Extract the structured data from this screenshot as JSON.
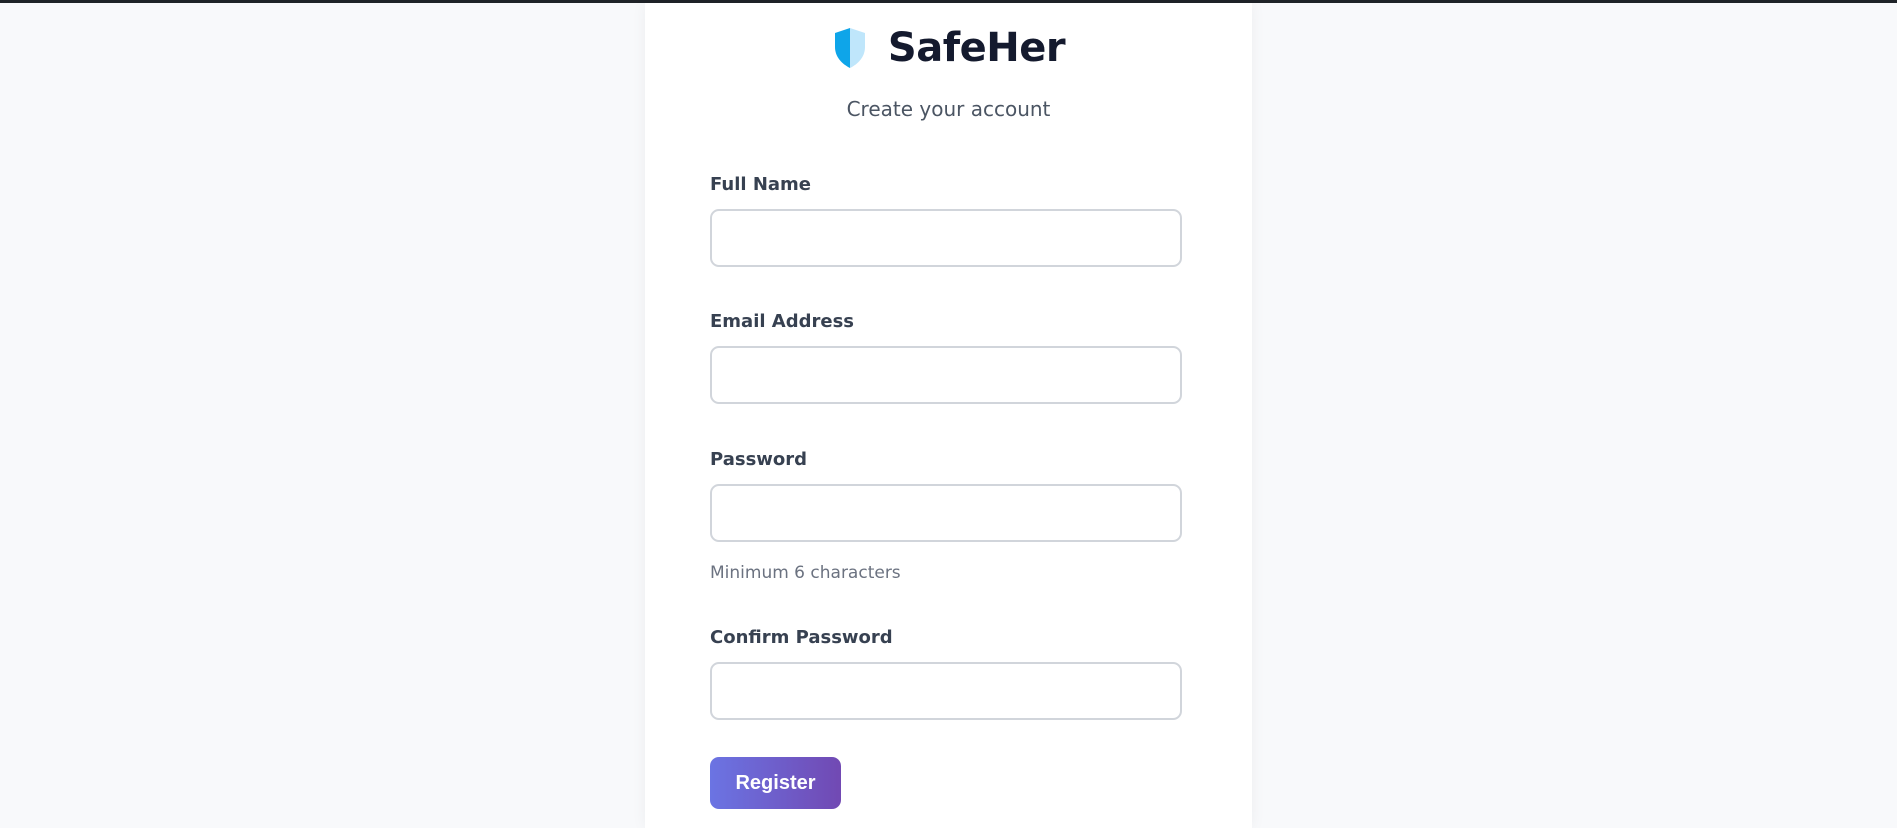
{
  "brand": {
    "name": "SafeHer",
    "icon": "shield-icon",
    "icon_colors": {
      "left": "#0ea5e9",
      "right": "#bfe6fb"
    }
  },
  "subtitle": "Create your account",
  "form": {
    "full_name": {
      "label": "Full Name",
      "value": "",
      "placeholder": ""
    },
    "email": {
      "label": "Email Address",
      "value": "",
      "placeholder": ""
    },
    "password": {
      "label": "Password",
      "value": "",
      "placeholder": "",
      "hint": "Minimum 6 characters"
    },
    "confirm_password": {
      "label": "Confirm Password",
      "value": "",
      "placeholder": ""
    }
  },
  "register_button": {
    "label": "Register"
  },
  "colors": {
    "background": "#f8f9fb",
    "card": "#ffffff",
    "button_gradient_start": "#6b74e3",
    "button_gradient_end": "#7149b3"
  }
}
